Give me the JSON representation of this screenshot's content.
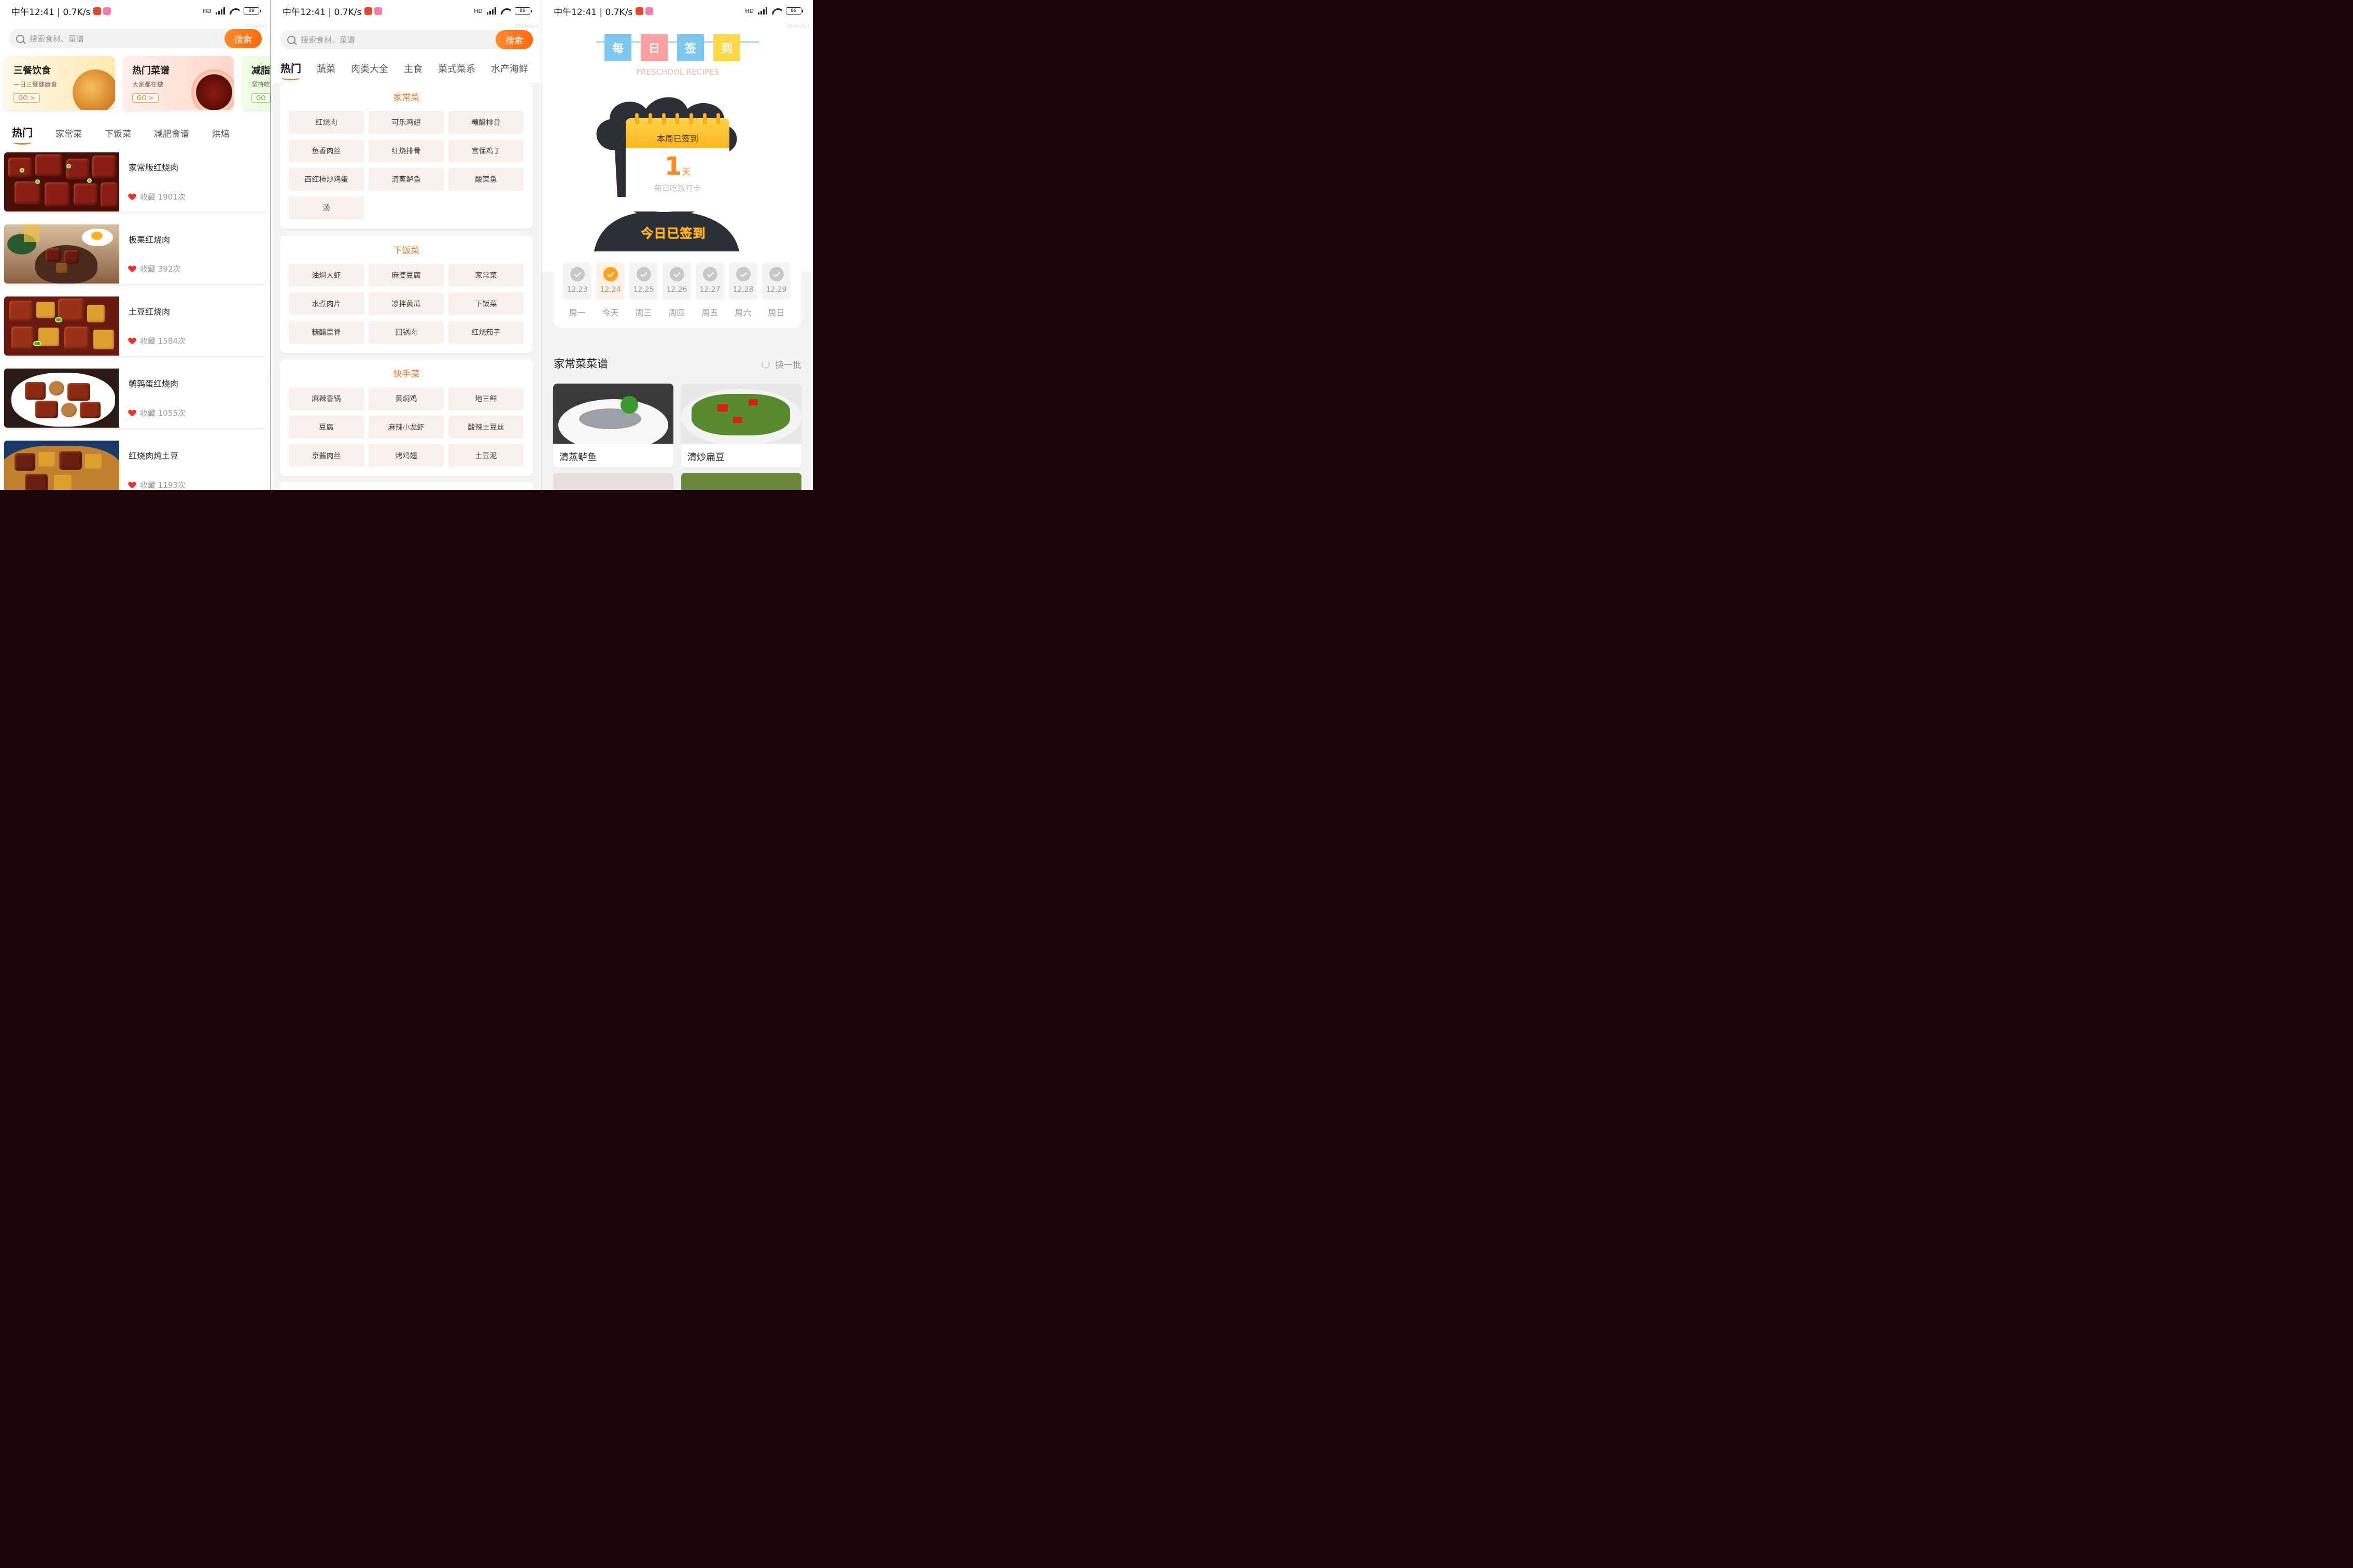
{
  "status_bar": {
    "time": "中午12:41 | 0.7K/s",
    "network": "HD",
    "battery": "89"
  },
  "watermark": "2914a2e1",
  "search": {
    "placeholder": "搜索食材、菜谱",
    "button": "搜索"
  },
  "panel1": {
    "promos": [
      {
        "title": "三餐饮食",
        "subtitle": "一日三餐健康食",
        "go": "GO >"
      },
      {
        "title": "热门菜谱",
        "subtitle": "大家都在做",
        "go": "GO >"
      },
      {
        "title": "减脂",
        "subtitle": "坚持吃",
        "go": "GO"
      }
    ],
    "tabs": [
      "热门",
      "家常菜",
      "下饭菜",
      "减肥食谱",
      "烘焙"
    ],
    "fav_label": "收藏",
    "recipes": [
      {
        "name": "家常版红烧肉",
        "fav": "收藏 1901次"
      },
      {
        "name": "板栗红烧肉",
        "fav": "收藏 392次"
      },
      {
        "name": "土豆红烧肉",
        "fav": "收藏 1584次"
      },
      {
        "name": "鹌鹑蛋红烧肉",
        "fav": "收藏 1055次"
      },
      {
        "name": "红烧肉炖土豆",
        "fav": "收藏 1193次"
      }
    ]
  },
  "panel2": {
    "tabs": [
      "热门",
      "蔬菜",
      "肉类大全",
      "主食",
      "菜式菜系",
      "水产海鲜"
    ],
    "categories": [
      {
        "title": "家常菜",
        "items": [
          "红烧肉",
          "可乐鸡翅",
          "糖醋排骨",
          "鱼香肉丝",
          "红烧排骨",
          "宫保鸡丁",
          "西红柿炒鸡蛋",
          "清蒸鲈鱼",
          "酸菜鱼",
          "汤"
        ]
      },
      {
        "title": "下饭菜",
        "items": [
          "油焖大虾",
          "麻婆豆腐",
          "家常菜",
          "水煮肉片",
          "凉拌黄瓜",
          "下饭菜",
          "糖醋里脊",
          "回锅肉",
          "红烧茄子"
        ]
      },
      {
        "title": "快手菜",
        "items": [
          "麻辣香锅",
          "黄焖鸡",
          "地三鲜",
          "豆腐",
          "麻辣小龙虾",
          "酸辣土豆丝",
          "京酱肉丝",
          "烤鸡翅",
          "土豆泥"
        ]
      }
    ]
  },
  "panel3": {
    "banner": [
      "每",
      "日",
      "签",
      "到"
    ],
    "banner_colors": [
      "#7cc8ee",
      "#f8a0a0",
      "#7cc8ee",
      "#ffd84a"
    ],
    "subtitle": "PRESCHOOL RECIPES",
    "calendar": {
      "label": "本周已签到",
      "count": "1",
      "unit": "天",
      "caption": "每日吃饭打卡"
    },
    "checked_today": "今日已签到",
    "days": [
      {
        "date": "12.23",
        "week": "周一",
        "today": false
      },
      {
        "date": "12.24",
        "week": "今天",
        "today": true
      },
      {
        "date": "12.25",
        "week": "周三",
        "today": false
      },
      {
        "date": "12.26",
        "week": "周四",
        "today": false
      },
      {
        "date": "12.27",
        "week": "周五",
        "today": false
      },
      {
        "date": "12.28",
        "week": "周六",
        "today": false
      },
      {
        "date": "12.29",
        "week": "周日",
        "today": false
      }
    ],
    "section_title": "家常菜菜谱",
    "refresh": "换一批",
    "dishes": [
      {
        "name": "清蒸鲈鱼"
      },
      {
        "name": "清炒扁豆"
      }
    ]
  }
}
